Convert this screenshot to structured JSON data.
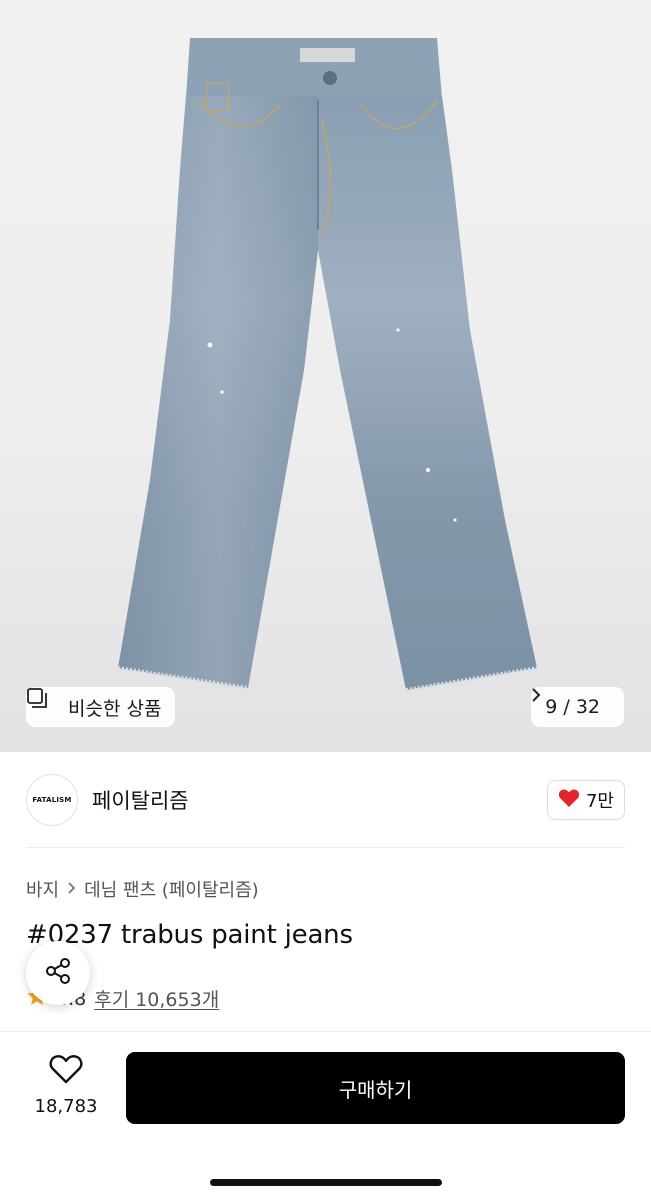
{
  "gallery": {
    "similar_label": "비슷한 상품",
    "counter": "9 / 32"
  },
  "brand": {
    "logo_text": "FATALISM",
    "name": "페이탈리즘",
    "like_count": "7만"
  },
  "breadcrumb": {
    "category": "바지",
    "subcategory": "데님 팬츠 (페이탈리즘)"
  },
  "product": {
    "title": "#0237 trabus paint jeans",
    "rating": "4.8",
    "reviews": "후기 10,653개"
  },
  "bottom": {
    "wish_count": "18,783",
    "buy_label": "구매하기"
  },
  "icons": {
    "similar": "similar-products-icon",
    "chevron": "chevron-right-icon",
    "heart": "heart-icon",
    "share": "share-icon",
    "star": "star-icon"
  },
  "colors": {
    "heart": "#e3262b",
    "star": "#f5a623",
    "buy_button": "#000000"
  }
}
